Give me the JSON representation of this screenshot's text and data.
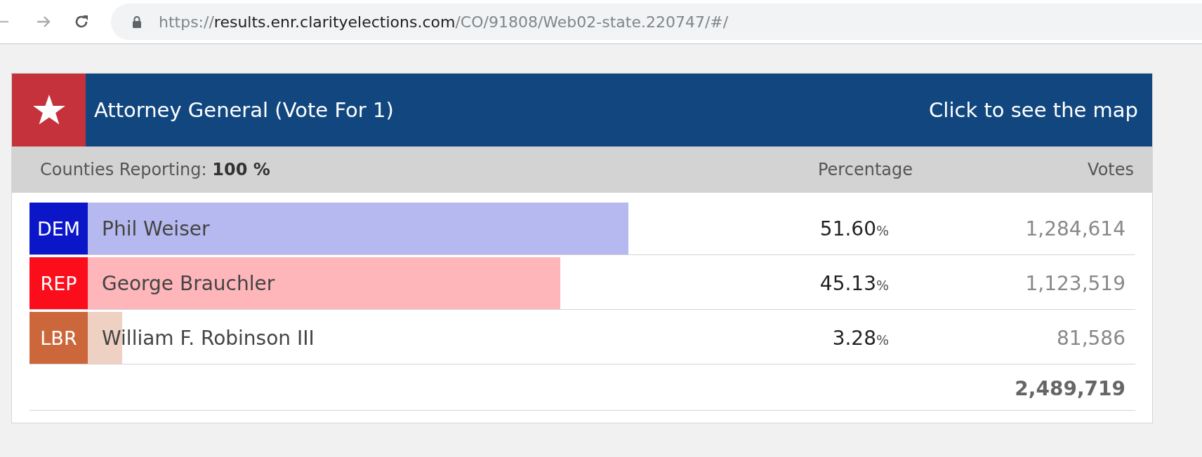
{
  "browser": {
    "url": {
      "scheme": "https://",
      "host": "results.enr.clarityelections.com",
      "path": "/CO/91808/Web02-state.220747/#/"
    }
  },
  "contest": {
    "title": "Attorney General (Vote For 1)",
    "map_link": "Click to see the map",
    "reporting_label": "Counties Reporting:",
    "reporting_value": "100 %",
    "columns": [
      "Percentage",
      "Votes"
    ],
    "rows": [
      {
        "party": "DEM",
        "color": "#0a16c8",
        "name": "Phil Weiser",
        "level": 0.516,
        "percentage": "51.60",
        "percent_sign": "%",
        "votes": "1,284,614"
      },
      {
        "party": "REP",
        "color": "#fc0d1b",
        "name": "George Brauchler",
        "level": 0.4513,
        "percentage": "45.13",
        "percent_sign": "%",
        "votes": "1,123,519"
      },
      {
        "party": "LBR",
        "color": "#cb673a",
        "name": "William F. Robinson III",
        "level": 0.0328,
        "percentage": "3.28",
        "percent_sign": "%",
        "votes": "81,586"
      }
    ],
    "total": "2,489,719"
  }
}
